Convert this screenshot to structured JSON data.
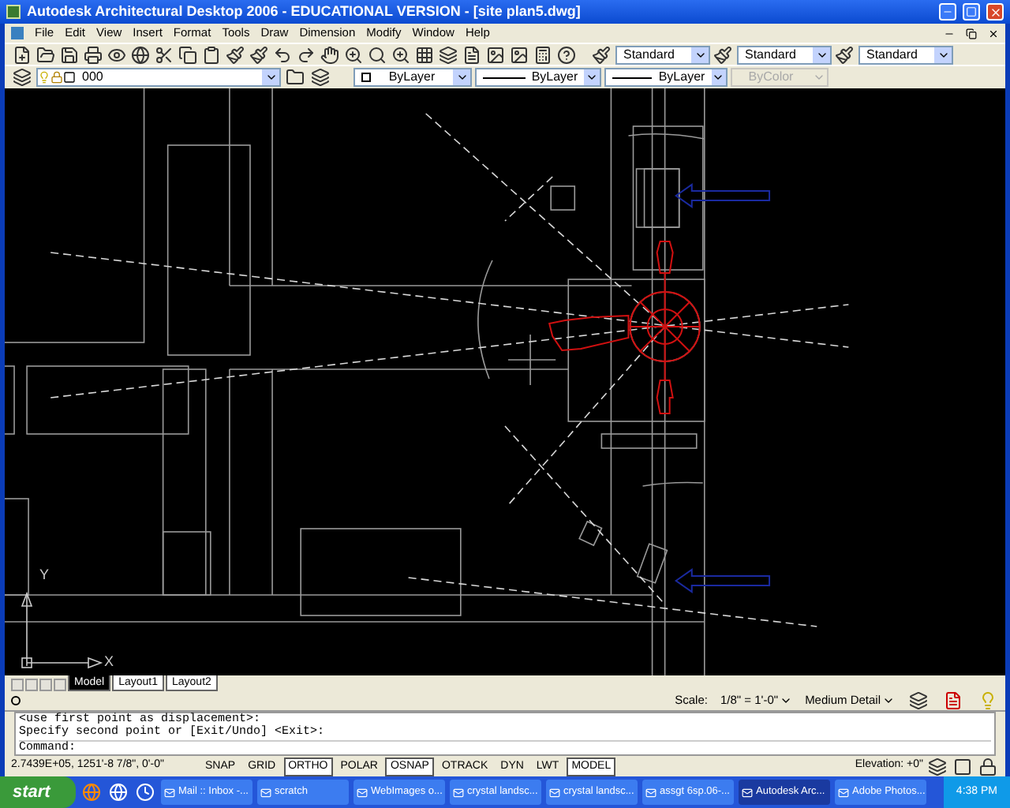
{
  "window": {
    "title": "Autodesk Architectural Desktop 2006 - EDUCATIONAL VERSION - [site plan5.dwg]"
  },
  "menu": [
    "File",
    "Edit",
    "View",
    "Insert",
    "Format",
    "Tools",
    "Draw",
    "Dimension",
    "Modify",
    "Window",
    "Help"
  ],
  "toolbar_styles": [
    {
      "value": "Standard"
    },
    {
      "value": "Standard"
    },
    {
      "value": "Standard"
    }
  ],
  "layer": {
    "value": "000"
  },
  "properties": [
    {
      "value": "ByLayer",
      "kind": "color",
      "disabled": false
    },
    {
      "value": "ByLayer",
      "kind": "linetype",
      "disabled": false
    },
    {
      "value": "ByLayer",
      "kind": "lineweight",
      "disabled": false
    },
    {
      "value": "ByColor",
      "kind": "plotstyle",
      "disabled": true
    }
  ],
  "ucs": {
    "x_label": "X",
    "y_label": "Y"
  },
  "layout_tabs": [
    {
      "label": "Model",
      "selected": true
    },
    {
      "label": "Layout1",
      "selected": false
    },
    {
      "label": "Layout2",
      "selected": false
    }
  ],
  "drawing_status": {
    "scale_label": "Scale:",
    "scale": "1/8\" = 1'-0\"",
    "detail": "Medium Detail"
  },
  "command_lines": [
    "<use first point as displacement>:",
    "Specify second point or [Exit/Undo] <Exit>:"
  ],
  "command_prompt": "Command:",
  "coordinates": "2.7439E+05, 1251'-8 7/8\", 0'-0\"",
  "toggles": [
    {
      "label": "SNAP",
      "on": false
    },
    {
      "label": "GRID",
      "on": false
    },
    {
      "label": "ORTHO",
      "on": true
    },
    {
      "label": "POLAR",
      "on": false
    },
    {
      "label": "OSNAP",
      "on": true
    },
    {
      "label": "OTRACK",
      "on": false
    },
    {
      "label": "DYN",
      "on": false
    },
    {
      "label": "LWT",
      "on": false
    },
    {
      "label": "MODEL",
      "on": true
    }
  ],
  "elevation": "Elevation: +0\"",
  "taskbar": {
    "start": "start",
    "tasks": [
      {
        "label": "Mail :: Inbox -...",
        "selected": false
      },
      {
        "label": "scratch",
        "selected": false
      },
      {
        "label": "WebImages o...",
        "selected": false
      },
      {
        "label": "crystal landsc...",
        "selected": false
      },
      {
        "label": "crystal landsc...",
        "selected": false
      },
      {
        "label": "assgt 6sp.06-...",
        "selected": false
      },
      {
        "label": "Autodesk Arc...",
        "selected": true
      },
      {
        "label": "Adobe Photos...",
        "selected": false
      }
    ],
    "clock": "4:38 PM"
  }
}
